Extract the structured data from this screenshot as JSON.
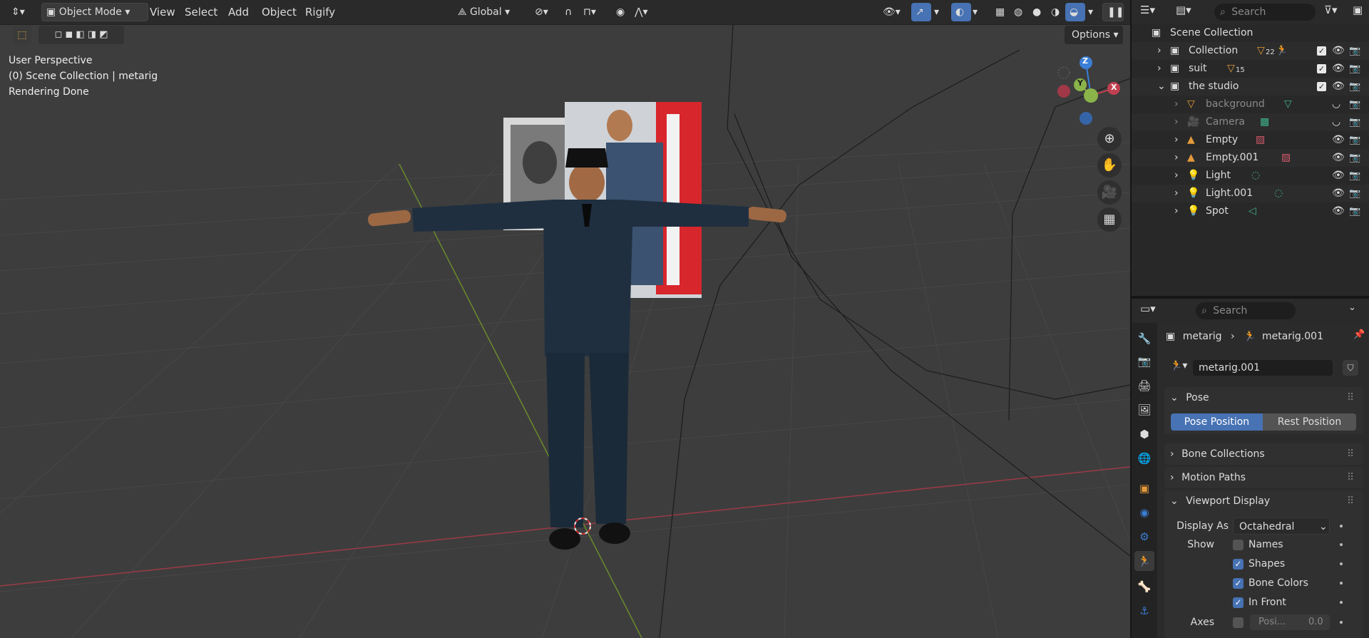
{
  "header": {
    "mode": "Object Mode",
    "menus": [
      "View",
      "Select",
      "Add",
      "Object",
      "Rigify"
    ],
    "transform_orientation": "Global",
    "options": "Options"
  },
  "overlay_text": {
    "perspective": "User Perspective",
    "collection": "(0) Scene Collection | metarig",
    "status": "Rendering Done"
  },
  "gizmo": {
    "z": "Z",
    "y": "Y",
    "x": "X"
  },
  "outliner": {
    "search_placeholder": "Search",
    "root": "Scene Collection",
    "rows": [
      {
        "label": "Collection",
        "count": "22"
      },
      {
        "label": "suit",
        "count": "15"
      },
      {
        "label": "the studio"
      },
      {
        "label": "background"
      },
      {
        "label": "Camera"
      },
      {
        "label": "Empty"
      },
      {
        "label": "Empty.001"
      },
      {
        "label": "Light"
      },
      {
        "label": "Light.001"
      },
      {
        "label": "Spot"
      }
    ]
  },
  "properties": {
    "search_placeholder": "Search",
    "breadcrumb": {
      "object": "metarig",
      "data": "metarig.001"
    },
    "datablock_name": "metarig.001",
    "pose": {
      "title": "Pose",
      "pose_position": "Pose Position",
      "rest_position": "Rest Position"
    },
    "bone_collections": "Bone Collections",
    "motion_paths": "Motion Paths",
    "viewport_display": {
      "title": "Viewport Display",
      "display_as_label": "Display As",
      "display_as_value": "Octahedral",
      "show_label": "Show",
      "names": "Names",
      "shapes": "Shapes",
      "bone_colors": "Bone Colors",
      "in_front": "In Front",
      "axes_label": "Axes",
      "axes_position_label": "Posi...",
      "axes_position_value": "0.0"
    }
  },
  "colors": {
    "accent": "#4772b3",
    "x_axis": "#c04050",
    "y_axis": "#8ab34a"
  }
}
